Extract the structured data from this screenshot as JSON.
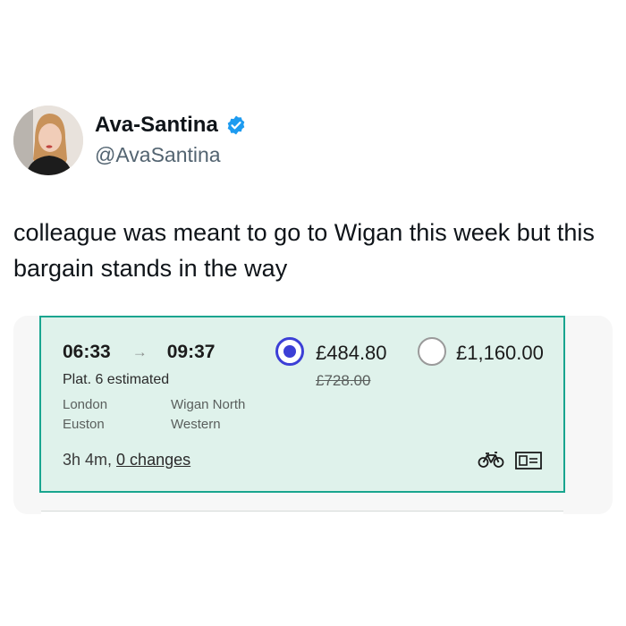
{
  "tweet": {
    "display_name": "Ava-Santina",
    "handle": "@AvaSantina",
    "text": "colleague was meant to go to Wigan this week but this bargain stands in the way",
    "verified_color": "#1d9bf0"
  },
  "journey": {
    "depart_time": "06:33",
    "arrow": "→",
    "arrive_time": "09:37",
    "platform": "Plat. 6 estimated",
    "origin_line1": "London",
    "origin_line2": "Euston",
    "destination_line1": "Wigan North",
    "destination_line2": "Western",
    "duration": "3h 4m,",
    "changes": "0 changes",
    "fare_1": "£484.80",
    "fare_1_original": "£728.00",
    "fare_1_selected": true,
    "fare_2": "£1,160.00",
    "fare_2_selected": false,
    "icons": [
      "bike-icon",
      "ticket-icon"
    ],
    "accent_color": "#19a58f",
    "card_color": "#dff2eb",
    "radio_color": "#3c3fd6"
  }
}
